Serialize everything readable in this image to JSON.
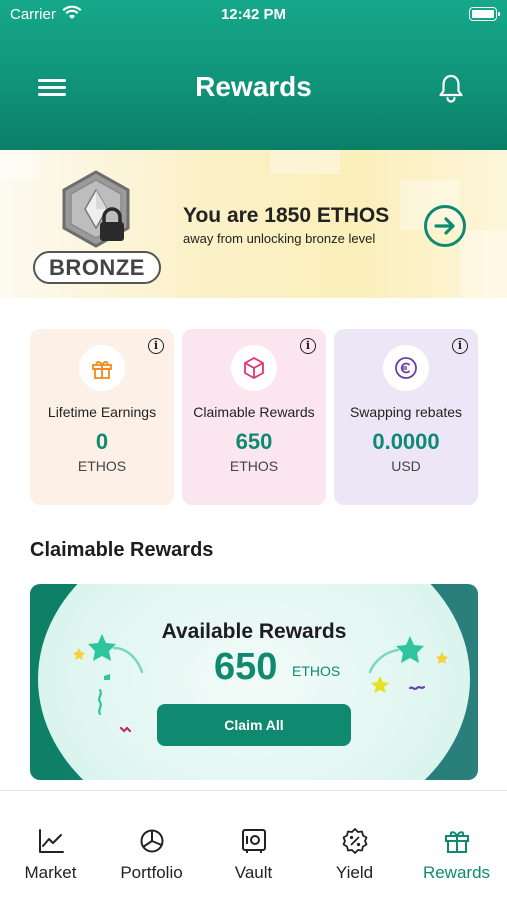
{
  "status_bar": {
    "carrier": "Carrier",
    "time": "12:42 PM"
  },
  "header": {
    "title": "Rewards"
  },
  "banner": {
    "badge_label": "BRONZE",
    "heading": "You are 1850 ETHOS",
    "subtext": "away from unlocking bronze level"
  },
  "stats": [
    {
      "label": "Lifetime Earnings",
      "value": "0",
      "unit": "ETHOS",
      "icon": "gift-icon"
    },
    {
      "label": "Claimable Rewards",
      "value": "650",
      "unit": "ETHOS",
      "icon": "cube-icon"
    },
    {
      "label": "Swapping rebates",
      "value": "0.0000",
      "unit": "USD",
      "icon": "coin-icon"
    }
  ],
  "info_glyph": "i",
  "claimable_section": {
    "title": "Claimable Rewards",
    "panel_title": "Available Rewards",
    "amount": "650",
    "unit": "ETHOS",
    "button_label": "Claim All"
  },
  "tabs": [
    {
      "label": "Market",
      "icon": "chart-line-icon",
      "active": false
    },
    {
      "label": "Portfolio",
      "icon": "pie-chart-icon",
      "active": false
    },
    {
      "label": "Vault",
      "icon": "vault-icon",
      "active": false
    },
    {
      "label": "Yield",
      "icon": "percent-badge-icon",
      "active": false
    },
    {
      "label": "Rewards",
      "icon": "gift-icon",
      "active": true
    }
  ],
  "colors": {
    "brand_green": "#0f8a70",
    "header_gradient_top": "#16a88a",
    "card_orange_bg": "#fdf1e7",
    "card_pink_bg": "#fbe6f0",
    "card_purple_bg": "#ede6f6"
  }
}
